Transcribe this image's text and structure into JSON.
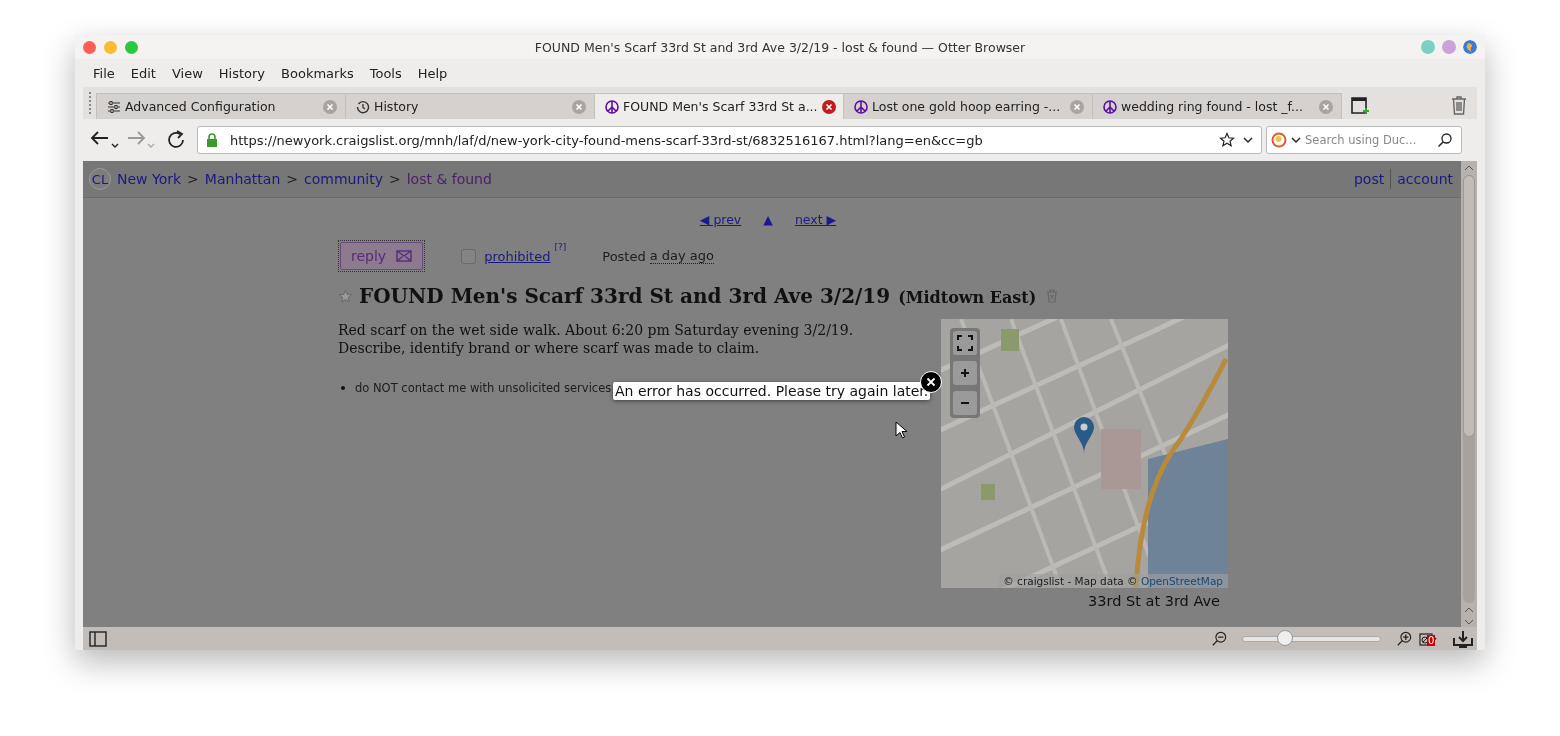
{
  "window": {
    "title": "FOUND Men's Scarf 33rd St and 3rd Ave 3/2/19 - lost & found — Otter Browser"
  },
  "menu": [
    "File",
    "Edit",
    "View",
    "History",
    "Bookmarks",
    "Tools",
    "Help"
  ],
  "tabs": [
    {
      "label": "Advanced Configuration",
      "kind": "settings",
      "selected": false
    },
    {
      "label": "History",
      "kind": "history",
      "selected": false
    },
    {
      "label": "FOUND Men's Scarf 33rd St a...",
      "kind": "peace",
      "selected": true
    },
    {
      "label": "Lost one gold hoop earring -...",
      "kind": "peace",
      "selected": false
    },
    {
      "label": "wedding ring found - lost _f...",
      "kind": "peace",
      "selected": false
    }
  ],
  "address": {
    "url": "https://newyork.craigslist.org/mnh/laf/d/new-york-city-found-mens-scarf-33rd-st/6832516167.html?lang=en&cc=gb",
    "secure": true
  },
  "search": {
    "placeholder": "Search using Duc..."
  },
  "page": {
    "logo": "CL",
    "breadcrumb": [
      {
        "label": "New York",
        "visited": false
      },
      {
        "label": "Manhattan",
        "visited": false
      },
      {
        "label": "community",
        "visited": false
      },
      {
        "label": "lost & found",
        "visited": true
      }
    ],
    "separator": ">",
    "header_links": [
      "post",
      "account"
    ],
    "pagination": {
      "prev": "◀ prev",
      "up": "▲",
      "next": "next ▶"
    },
    "reply": "reply",
    "prohibited": {
      "label": "prohibited",
      "help": "[?]",
      "checked": false
    },
    "posted": {
      "label": "Posted",
      "time": "a day ago"
    },
    "title": "FOUND Men's Scarf 33rd St and 3rd Ave 3/2/19",
    "location": "(Midtown East)",
    "body": [
      "Red scarf on the wet side walk. About 6:20 pm Saturday evening 3/2/19.",
      "Describe, identify brand or where scarf was made to claim."
    ],
    "notices": [
      "do NOT contact me with unsolicited services"
    ],
    "map": {
      "kind": "picture",
      "attribution": "© craigslist - Map data ©",
      "attribution_link": "OpenStreetMap",
      "address": "33rd St at 3rd Ave"
    }
  },
  "error": {
    "message": "An error has occurred. Please try again later."
  },
  "status_bar": {
    "zoom": {
      "level": 0.31
    },
    "blocked_count": "0"
  }
}
